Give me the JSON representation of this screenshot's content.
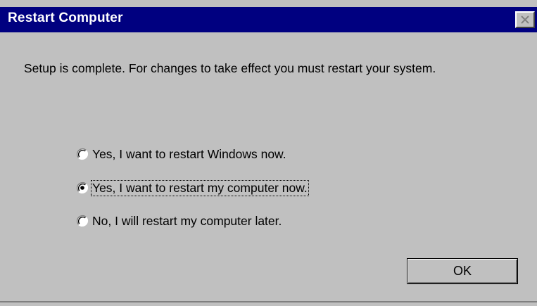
{
  "window": {
    "title": "Restart Computer",
    "colors": {
      "titlebar": "#000080",
      "face": "#c0c0c0"
    }
  },
  "message": "Setup is complete.  For changes to take effect you must restart your system.",
  "options": [
    {
      "label": "Yes, I want to restart Windows now.",
      "selected": false
    },
    {
      "label": "Yes, I want to restart my computer now.",
      "selected": true
    },
    {
      "label": "No, I will restart my computer later.",
      "selected": false
    }
  ],
  "buttons": {
    "ok_label": "OK",
    "close_icon": "close-icon"
  }
}
